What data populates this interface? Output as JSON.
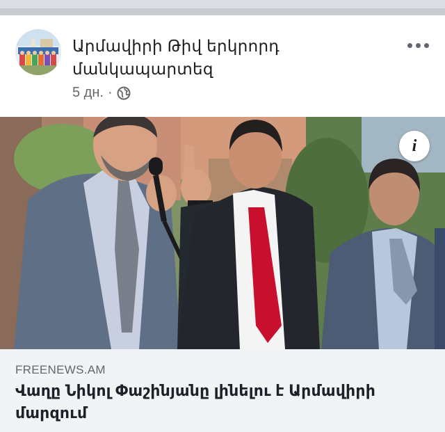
{
  "post": {
    "page_name": "Արմավիրի Թիվ երկրորդ մանկապարտեզ",
    "timestamp": "5 дн.",
    "separator": "·",
    "privacy_icon": "globe-icon",
    "more_icon": "more-options-icon"
  },
  "link_preview": {
    "domain": "FREENEWS.AM",
    "headline": "Վաղը Նիկոլ Փաշինյանը լինելու է Արմավիրի մարզում",
    "info_icon": "info-icon"
  },
  "colors": {
    "text_primary": "#1c1e21",
    "text_secondary": "#65676b",
    "preview_bg": "#f2f3f5",
    "tie_red": "#c8102e"
  }
}
